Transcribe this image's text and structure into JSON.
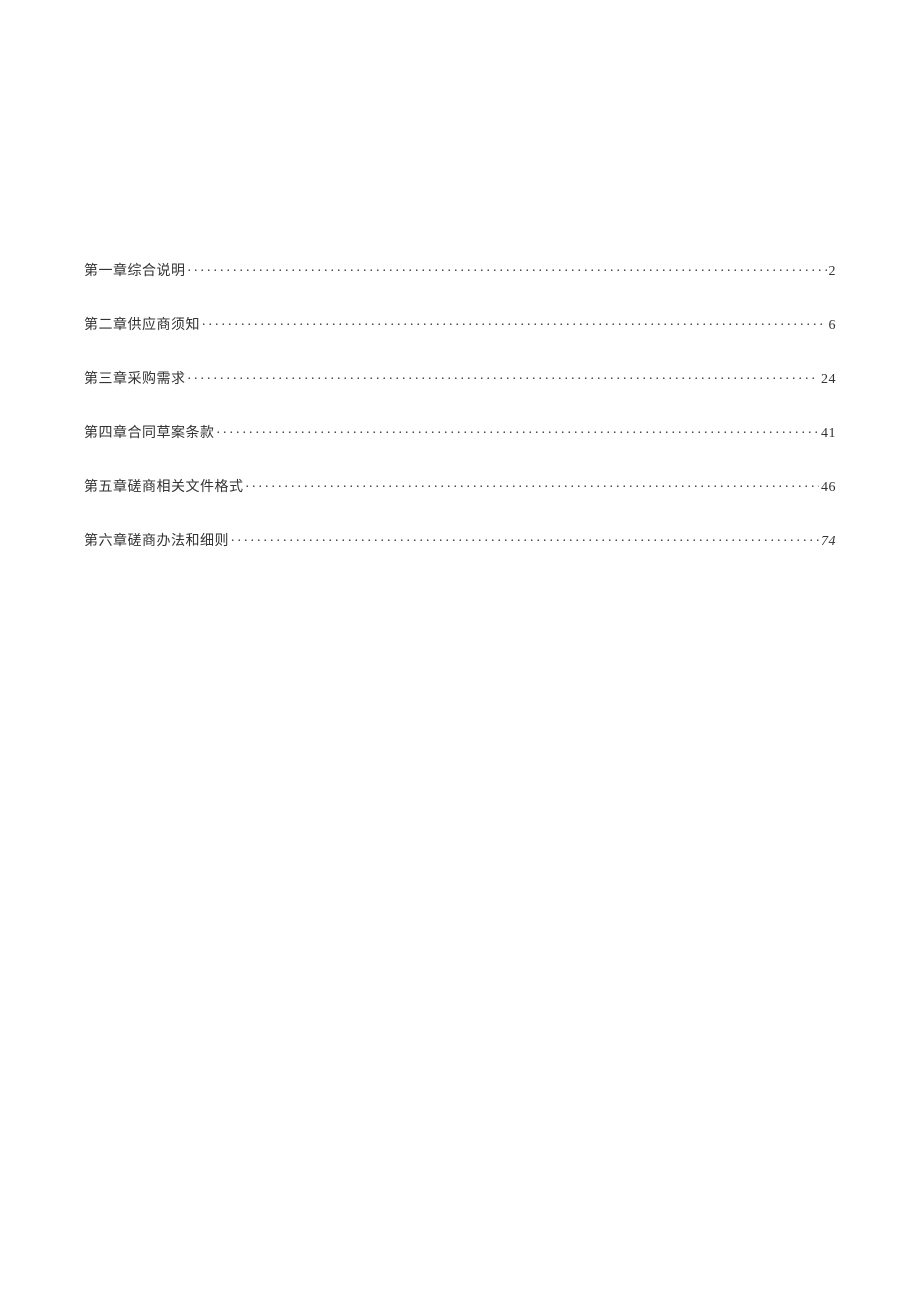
{
  "toc": {
    "entries": [
      {
        "title": "第一章综合说明",
        "page": "2",
        "italic": false
      },
      {
        "title": "第二章供应商须知",
        "page": "6",
        "italic": false
      },
      {
        "title": "第三章采购需求",
        "page": "24",
        "italic": false
      },
      {
        "title": "第四章合同草案条款",
        "page": "41",
        "italic": false
      },
      {
        "title": "第五章磋商相关文件格式",
        "page": "46",
        "italic": false
      },
      {
        "title": "第六章磋商办法和细则",
        "page": "74",
        "italic": true
      }
    ]
  }
}
